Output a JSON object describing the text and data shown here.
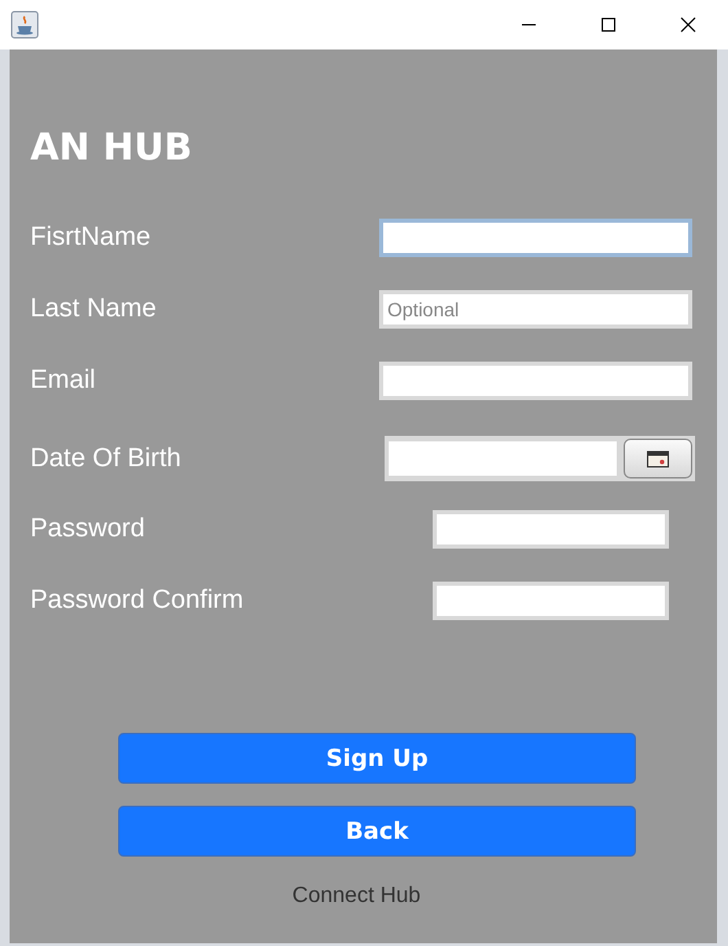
{
  "heading": "AN HUB",
  "fields": [
    {
      "label": "FisrtName",
      "kind": "text",
      "focused": true
    },
    {
      "label": "Last Name",
      "kind": "text",
      "focused": false,
      "placeholder": "Optional"
    },
    {
      "label": "Email",
      "kind": "text",
      "focused": false
    },
    {
      "label": "Date Of Birth",
      "kind": "date",
      "focused": false
    },
    {
      "label": "Password",
      "kind": "password",
      "focused": false
    },
    {
      "label": "Password Confirm",
      "kind": "password",
      "focused": false
    }
  ],
  "buttons": [
    "Sign Up",
    "Back"
  ],
  "footer": "Connect Hub"
}
